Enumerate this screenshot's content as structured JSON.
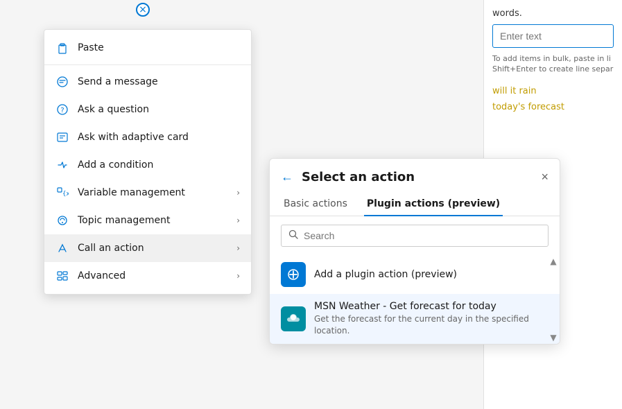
{
  "background": {
    "words_label": "words.",
    "enter_text_placeholder": "Enter text",
    "hint_text": "To add items in bulk, paste in li Shift+Enter to create line separ",
    "tag1": "will it rain",
    "tag2": "today's forecast"
  },
  "node_connector": {
    "label": "×"
  },
  "context_menu": {
    "items": [
      {
        "id": "paste",
        "label": "Paste",
        "icon": "paste",
        "has_arrow": false
      },
      {
        "id": "send-message",
        "label": "Send a message",
        "icon": "message",
        "has_arrow": false
      },
      {
        "id": "ask-question",
        "label": "Ask a question",
        "icon": "question",
        "has_arrow": false
      },
      {
        "id": "ask-adaptive",
        "label": "Ask with adaptive card",
        "icon": "adaptive",
        "has_arrow": false
      },
      {
        "id": "add-condition",
        "label": "Add a condition",
        "icon": "condition",
        "has_arrow": false
      },
      {
        "id": "variable-mgmt",
        "label": "Variable management",
        "icon": "variable",
        "has_arrow": true
      },
      {
        "id": "topic-mgmt",
        "label": "Topic management",
        "icon": "topic",
        "has_arrow": true
      },
      {
        "id": "call-action",
        "label": "Call an action",
        "icon": "action",
        "has_arrow": true
      },
      {
        "id": "advanced",
        "label": "Advanced",
        "icon": "advanced",
        "has_arrow": true
      }
    ]
  },
  "action_panel": {
    "title": "Select an action",
    "back_label": "←",
    "close_label": "×",
    "tabs": [
      {
        "id": "basic",
        "label": "Basic actions",
        "active": false
      },
      {
        "id": "plugin",
        "label": "Plugin actions (preview)",
        "active": true
      }
    ],
    "search_placeholder": "Search",
    "actions": [
      {
        "id": "add-plugin",
        "name": "Add a plugin action (preview)",
        "description": "",
        "icon_type": "plugin"
      },
      {
        "id": "msn-weather",
        "name": "MSN Weather - Get forecast for today",
        "description": "Get the forecast for the current day in the specified location.",
        "icon_type": "weather"
      }
    ]
  }
}
